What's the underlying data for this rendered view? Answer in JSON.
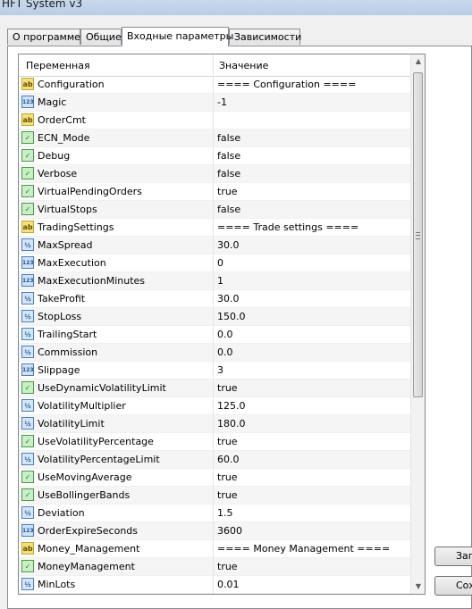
{
  "window": {
    "title": "HFT System v3"
  },
  "tabs": [
    {
      "label": "О программе",
      "active": false
    },
    {
      "label": "Общие",
      "active": false
    },
    {
      "label": "Входные параметры",
      "active": true
    },
    {
      "label": "Зависимости",
      "active": false
    }
  ],
  "grid": {
    "columns": {
      "variable": "Переменная",
      "value": "Значение"
    },
    "rows": [
      {
        "type": "string",
        "icon": "ab",
        "name": "Configuration",
        "value": "==== Configuration ===="
      },
      {
        "type": "int",
        "icon": "123",
        "name": "Magic",
        "value": "-1"
      },
      {
        "type": "string",
        "icon": "ab",
        "name": "OrderCmt",
        "value": ""
      },
      {
        "type": "bool",
        "icon": "✓",
        "name": "ECN_Mode",
        "value": "false"
      },
      {
        "type": "bool",
        "icon": "✓",
        "name": "Debug",
        "value": "false"
      },
      {
        "type": "bool",
        "icon": "✓",
        "name": "Verbose",
        "value": "false"
      },
      {
        "type": "bool",
        "icon": "✓",
        "name": "VirtualPendingOrders",
        "value": "true"
      },
      {
        "type": "bool",
        "icon": "✓",
        "name": "VirtualStops",
        "value": "false"
      },
      {
        "type": "string",
        "icon": "ab",
        "name": "TradingSettings",
        "value": "==== Trade settings ===="
      },
      {
        "type": "double",
        "icon": "½",
        "name": "MaxSpread",
        "value": "30.0"
      },
      {
        "type": "int",
        "icon": "123",
        "name": "MaxExecution",
        "value": "0"
      },
      {
        "type": "int",
        "icon": "123",
        "name": "MaxExecutionMinutes",
        "value": "1"
      },
      {
        "type": "double",
        "icon": "½",
        "name": "TakeProfit",
        "value": "30.0"
      },
      {
        "type": "double",
        "icon": "½",
        "name": "StopLoss",
        "value": "150.0"
      },
      {
        "type": "double",
        "icon": "½",
        "name": "TrailingStart",
        "value": "0.0"
      },
      {
        "type": "double",
        "icon": "½",
        "name": "Commission",
        "value": "0.0"
      },
      {
        "type": "int",
        "icon": "123",
        "name": "Slippage",
        "value": "3"
      },
      {
        "type": "bool",
        "icon": "✓",
        "name": "UseDynamicVolatilityLimit",
        "value": "true"
      },
      {
        "type": "double",
        "icon": "½",
        "name": "VolatilityMultiplier",
        "value": "125.0"
      },
      {
        "type": "double",
        "icon": "½",
        "name": "VolatilityLimit",
        "value": "180.0"
      },
      {
        "type": "bool",
        "icon": "✓",
        "name": "UseVolatilityPercentage",
        "value": "true"
      },
      {
        "type": "double",
        "icon": "½",
        "name": "VolatilityPercentageLimit",
        "value": "60.0"
      },
      {
        "type": "bool",
        "icon": "✓",
        "name": "UseMovingAverage",
        "value": "true"
      },
      {
        "type": "bool",
        "icon": "✓",
        "name": "UseBollingerBands",
        "value": "true"
      },
      {
        "type": "double",
        "icon": "½",
        "name": "Deviation",
        "value": "1.5"
      },
      {
        "type": "int",
        "icon": "123",
        "name": "OrderExpireSeconds",
        "value": "3600"
      },
      {
        "type": "string",
        "icon": "ab",
        "name": "Money_Management",
        "value": "==== Money Management ===="
      },
      {
        "type": "bool",
        "icon": "✓",
        "name": "MoneyManagement",
        "value": "true"
      },
      {
        "type": "double",
        "icon": "½",
        "name": "MinLots",
        "value": "0.01"
      }
    ]
  },
  "buttons": {
    "load": "Заг",
    "save": "Сох"
  }
}
